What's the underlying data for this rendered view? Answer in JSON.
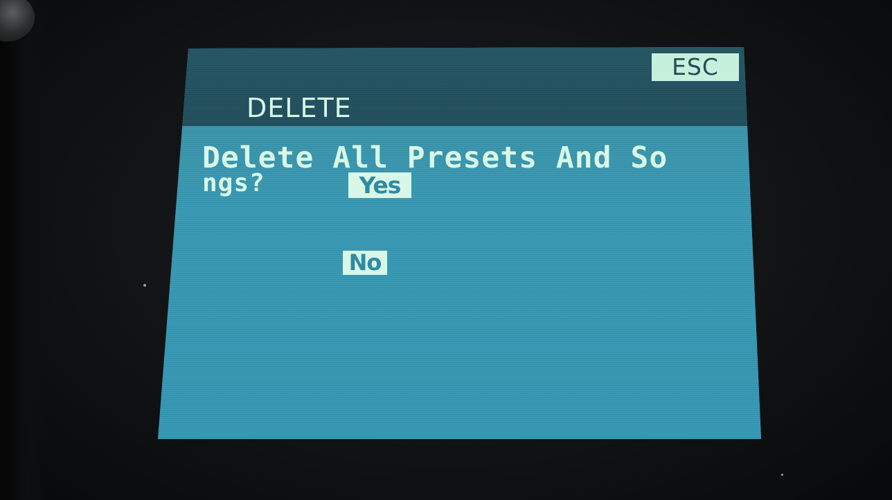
{
  "header": {
    "title": "DELETE",
    "esc_label": "ESC"
  },
  "dialog": {
    "prompt_line1": "Delete All Presets And So",
    "prompt_line2": "ngs?",
    "options": {
      "yes": "Yes",
      "no": "No"
    }
  },
  "colors": {
    "screen_background": "#3a9ab5",
    "header_background": "#24515f",
    "text": "#d8f7e6",
    "highlight_background": "#d8f7e6",
    "highlight_text": "#2f8aa4"
  },
  "icons": {
    "device_knob": "knob-icon"
  }
}
